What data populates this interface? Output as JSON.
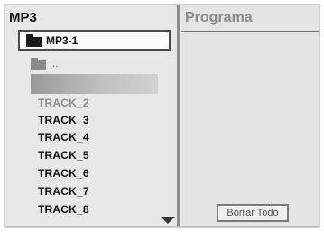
{
  "file_list": {
    "title": "MP3",
    "current_folder": "MP3-1",
    "parent_label": "..",
    "tracks": [
      {
        "label": "TRACK_2",
        "dimmed": true
      },
      {
        "label": "TRACK_3",
        "dimmed": false
      },
      {
        "label": "TRACK_4",
        "dimmed": false
      },
      {
        "label": "TRACK_5",
        "dimmed": false
      },
      {
        "label": "TRACK_6",
        "dimmed": false
      },
      {
        "label": "TRACK_7",
        "dimmed": false
      },
      {
        "label": "TRACK_8",
        "dimmed": false
      }
    ]
  },
  "program": {
    "title": "Programa",
    "clear_all_label": "Borrar Todo"
  },
  "icons": {
    "folder": "folder-icon",
    "parent_folder": "folder-up-icon",
    "scroll_down": "triangle-down-icon"
  }
}
